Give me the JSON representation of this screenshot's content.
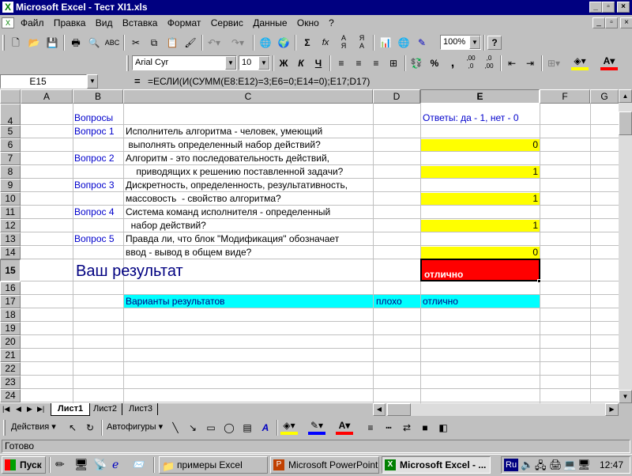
{
  "window": {
    "title": "Microsoft Excel - Тест XI1.xls"
  },
  "menu": [
    "Файл",
    "Правка",
    "Вид",
    "Вставка",
    "Формат",
    "Сервис",
    "Данные",
    "Окно",
    "?"
  ],
  "toolbar": {
    "zoom": "100%",
    "font": "Arial Cyr",
    "font_size": "10",
    "bold": "Ж",
    "italic": "К",
    "underline": "Ч",
    "percent": "%",
    "comma": ",",
    "inc_decimal": ",00\n,0",
    "dec_decimal": ",0\n,00",
    "sigma": "Σ",
    "fx": "fx"
  },
  "formula": {
    "name_box": "E15",
    "equals": "=",
    "text": "=ЕСЛИ(И(СУММ(E8:E12)=3;E6=0;E14=0);E17;D17)"
  },
  "columns": [
    "A",
    "B",
    "C",
    "D",
    "E",
    "F",
    "G"
  ],
  "rows": [
    "4",
    "5",
    "6",
    "7",
    "8",
    "9",
    "10",
    "11",
    "12",
    "13",
    "14",
    "15",
    "16",
    "17",
    "18",
    "19",
    "20",
    "21",
    "22",
    "23",
    "24"
  ],
  "cells": {
    "b4": "Вопросы",
    "e4": "Ответы: да - 1, нет - 0",
    "b5": "Вопрос 1",
    "c5": "Исполнитель алгоритма - человек, умеющий",
    "c6": " выполнять определенный набор действий?",
    "e6": "0",
    "b7": "Вопрос 2",
    "c7": "Алгоритм - это последовательность действий,",
    "c8": "    приводящих к решению поставленной задачи?",
    "e8": "1",
    "b9": "Вопрос 3",
    "c9": "Дискретность, определенность, результативность,",
    "c10": "массовость  - свойство алгоритма?",
    "e10": "1",
    "b11": "Вопрос 4",
    "c11": "Система команд исполнителя - определенный",
    "c12": "  набор действий?",
    "e12": "1",
    "b13": "Вопрос 5",
    "c13": "Правда ли, что блок \"Модификация\" обозначает",
    "c14": "ввод - вывод в общем виде?",
    "e14": "0",
    "b15": "Ваш результат",
    "e15": "отлично",
    "c17": "Варианты результатов",
    "d17": "плохо",
    "e17": "отлично"
  },
  "sheets": [
    "Лист1",
    "Лист2",
    "Лист3"
  ],
  "drawing": {
    "actions": "Действия",
    "autoshapes": "Автофигуры"
  },
  "status": "Готово",
  "taskbar": {
    "start": "Пуск",
    "tasks": [
      "примеры Excel",
      "Microsoft PowerPoint ...",
      "Microsoft Excel - ..."
    ],
    "lang": "Ru",
    "clock": "12:47"
  },
  "colors": {
    "title_bg": "#000080",
    "answer_fill": "#ffff00",
    "result_fill": "#ff0000",
    "variants_fill": "#00ffff",
    "question_text": "#0000cc"
  }
}
